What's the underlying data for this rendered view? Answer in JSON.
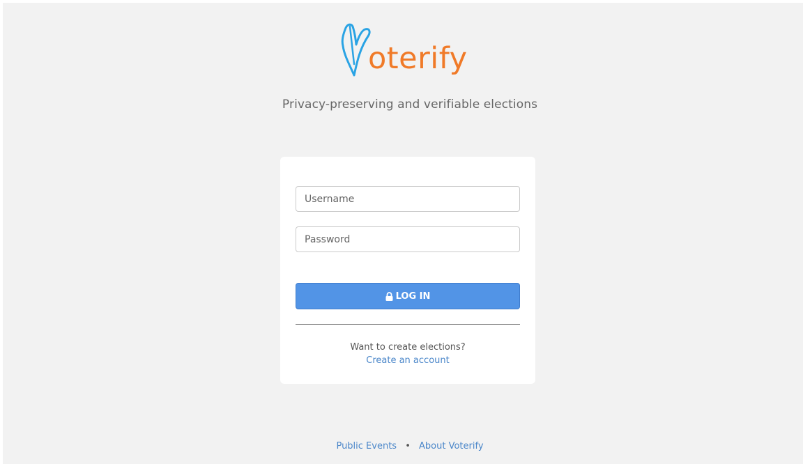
{
  "brand": {
    "logo_text": "oterify",
    "tagline": "Privacy-preserving and verifiable elections",
    "colors": {
      "logo_mark": "#2aa3e4",
      "logo_text": "#f07a28"
    }
  },
  "login": {
    "username_placeholder": "Username",
    "password_placeholder": "Password",
    "login_label": "LOG IN",
    "login_icon": "lock-icon",
    "button_color": "#5294e6"
  },
  "signup": {
    "prompt": "Want to create elections?",
    "link": "Create an account"
  },
  "footer": {
    "links": [
      "Public Events",
      "About Voterify"
    ],
    "separator": "•"
  }
}
